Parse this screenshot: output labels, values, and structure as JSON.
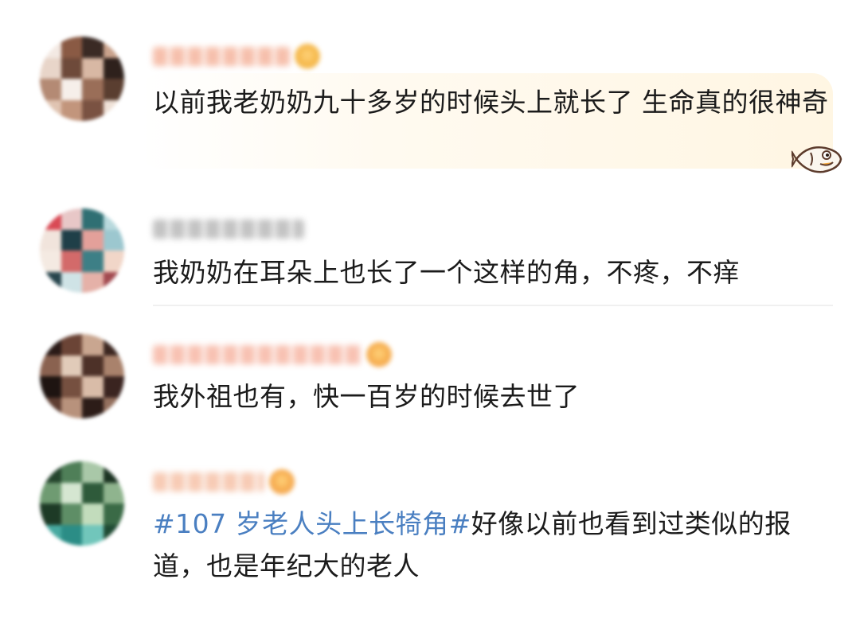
{
  "comments": [
    {
      "text": "以前我老奶奶九十多岁的时候头上就长了 生命真的很神奇",
      "avatar_colors": [
        "#f3e9e3",
        "#8a5a44",
        "#3a2a24",
        "#c9a28c",
        "#e8d5c9",
        "#6e4a3a",
        "#d8b8a4",
        "#2e211c",
        "#b48a74",
        "#f6efea",
        "#9a6e58",
        "#5a3e30",
        "#e0c4b2",
        "#c2957c",
        "#7a5242",
        "#efe2d8"
      ],
      "name_color": "#f5b59e",
      "badge_color": "#f4b545",
      "highlighted": true
    },
    {
      "text": "我奶奶在耳朵上也长了一个这样的角，不疼，不痒",
      "avatar_colors": [
        "#d94a55",
        "#e8c7c7",
        "#2f6f73",
        "#b8d9dd",
        "#f1e4dc",
        "#1f3f48",
        "#e3a09a",
        "#9cc7cf",
        "#f4eae2",
        "#d36a6a",
        "#3d7f86",
        "#f1d6c8",
        "#27454d",
        "#cfe3e6",
        "#e5b1a8",
        "#a24a50"
      ],
      "name_color": "#b9b9b9",
      "badge_color": "",
      "highlighted": false
    },
    {
      "text": "我外祖也有，快一百岁的时候去世了",
      "avatar_colors": [
        "#2a1a17",
        "#6b4436",
        "#c9a690",
        "#3b2620",
        "#8a6250",
        "#e1cbb9",
        "#4d3128",
        "#a9826c",
        "#1e1411",
        "#765040",
        "#d9bca8",
        "#3a2420",
        "#5e3d31",
        "#b8927c",
        "#2c1c18",
        "#94705e"
      ],
      "name_color": "#f7b7a5",
      "badge_color": "#f5a94a",
      "highlighted": false
    },
    {
      "text_hashtag": "#107 岁老人头上长犄角#",
      "text": "好像以前也看到过类似的报道，也是年纪大的老人",
      "avatar_colors": [
        "#25452e",
        "#4f7f58",
        "#a9c8a8",
        "#1b3322",
        "#6f9b72",
        "#d5e6d1",
        "#2e5a3a",
        "#8fb48e",
        "#1d3a26",
        "#5e8e66",
        "#c2dcbc",
        "#3a6a46",
        "#47a9a0",
        "#2b8d86",
        "#71c6bb",
        "#1f4a33"
      ],
      "name_color": "#f6c2a8",
      "badge_color": "#f5a64a",
      "highlighted": false
    }
  ]
}
